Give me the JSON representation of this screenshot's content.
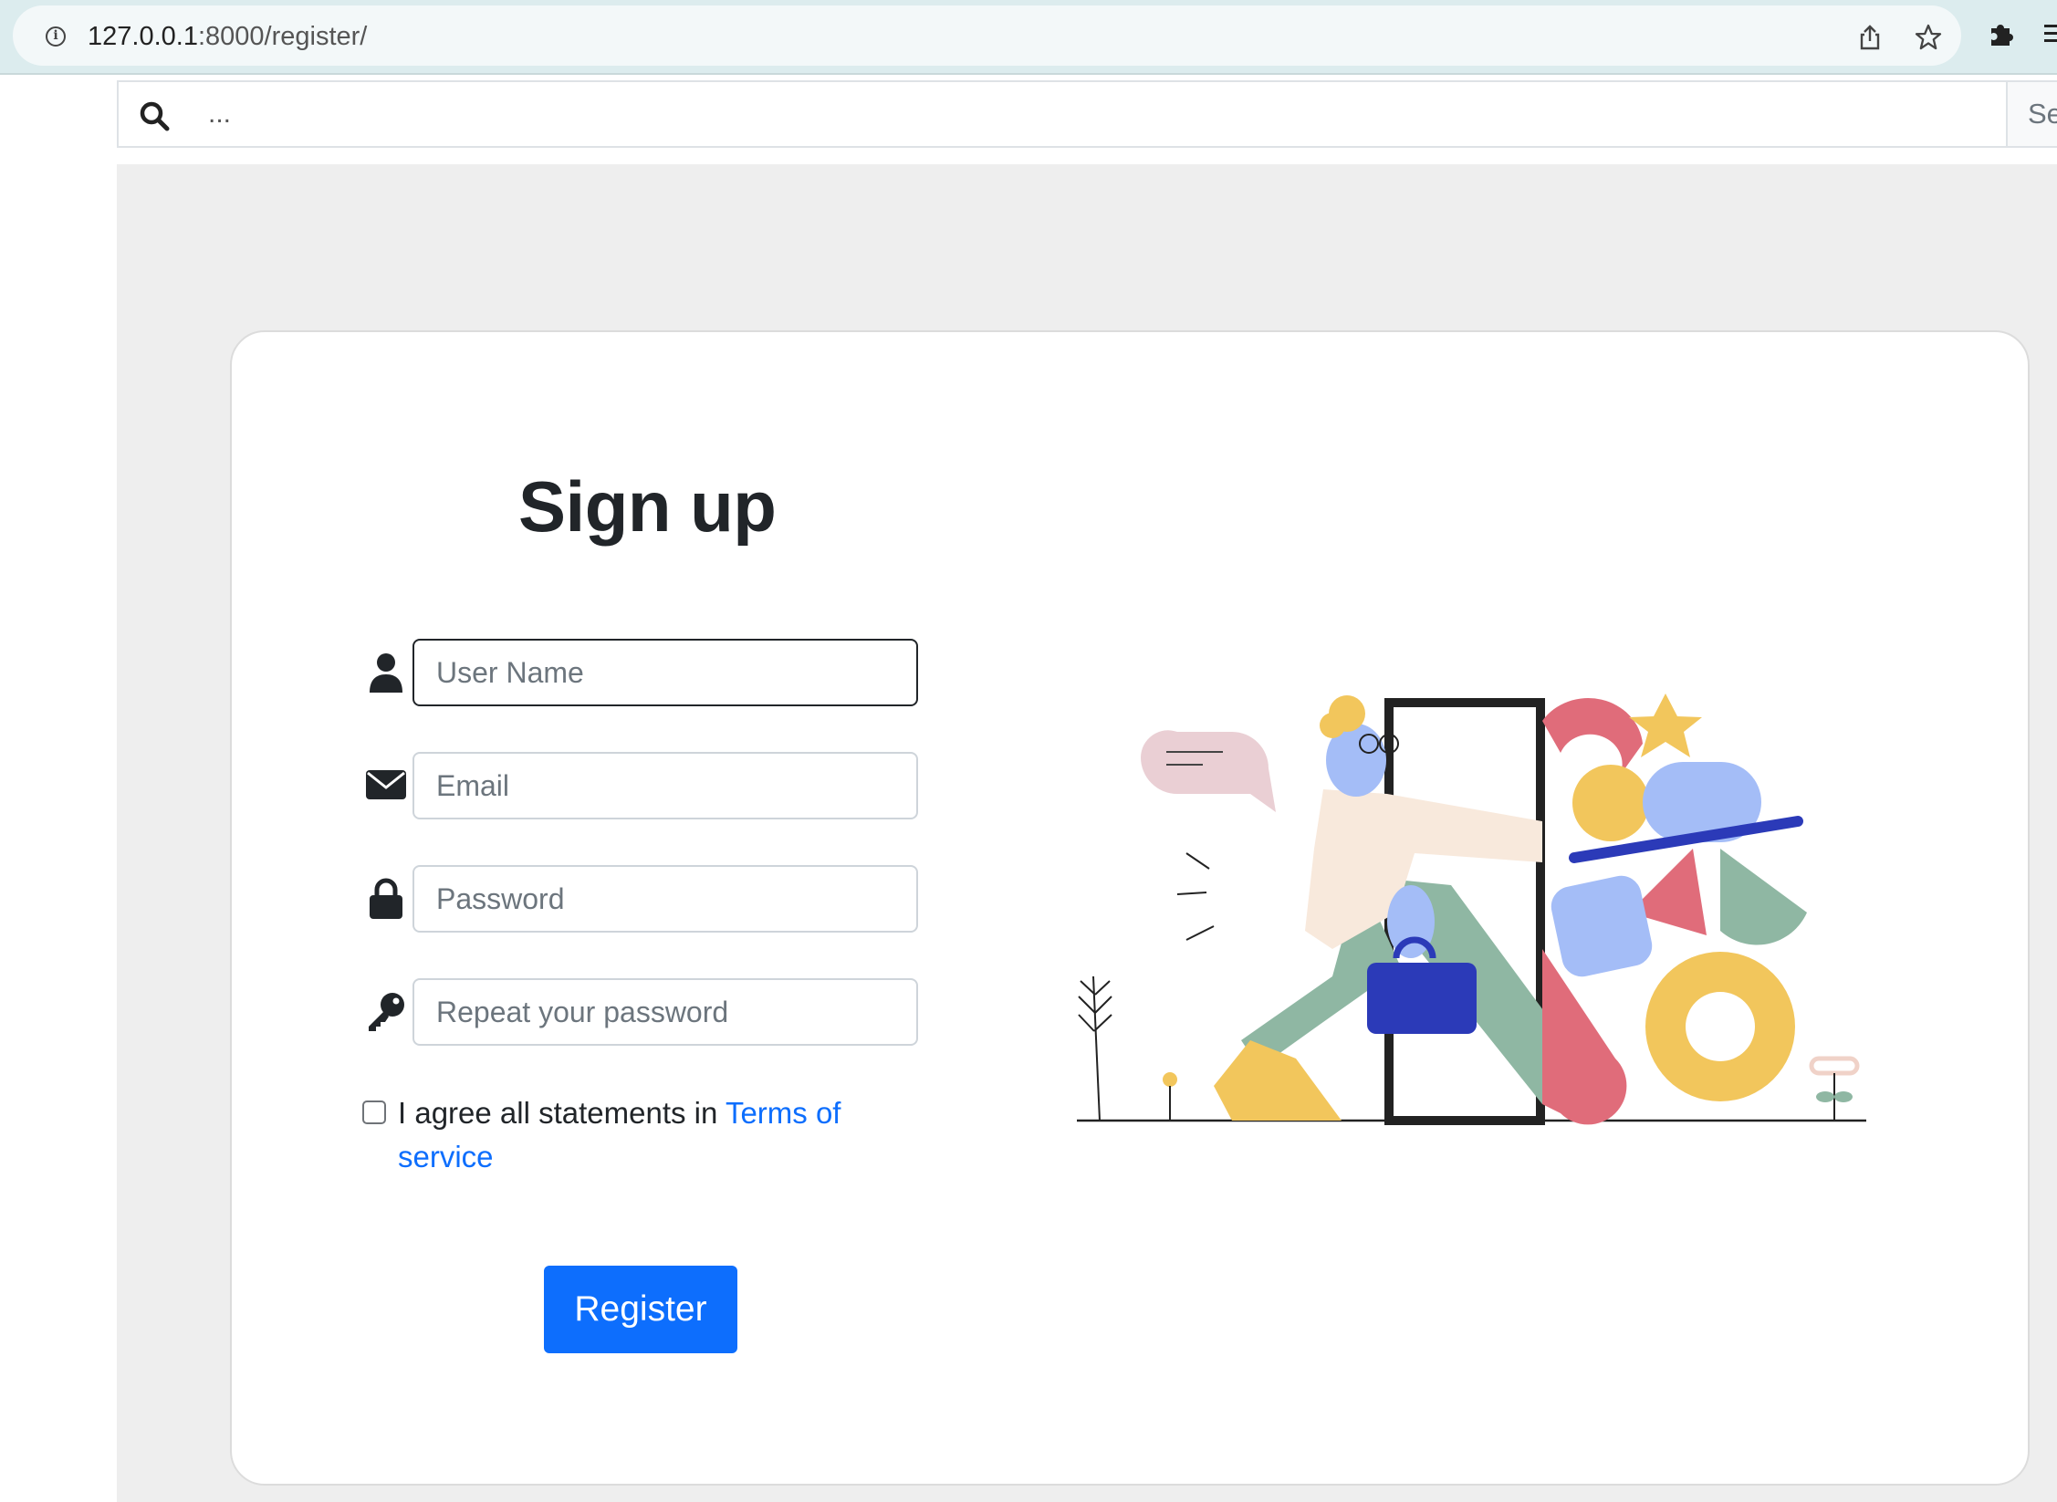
{
  "browser": {
    "url_host": "127.0.0.1",
    "url_rest": ":8000/register/",
    "icons": [
      "info-icon",
      "share-icon",
      "star-icon",
      "extensions-icon",
      "menu-icon"
    ]
  },
  "search": {
    "value": "...",
    "button_label": "Se"
  },
  "form": {
    "title": "Sign up",
    "fields": [
      {
        "icon": "user-icon",
        "placeholder": "User Name",
        "value": ""
      },
      {
        "icon": "envelope-icon",
        "placeholder": "Email",
        "value": ""
      },
      {
        "icon": "lock-icon",
        "placeholder": "Password",
        "value": ""
      },
      {
        "icon": "key-icon",
        "placeholder": "Repeat your password",
        "value": ""
      }
    ],
    "agree_text": "I agree all statements in ",
    "terms_link": "Terms of service",
    "agree_checked": false,
    "register_label": "Register"
  },
  "colors": {
    "primary": "#0d6efd",
    "page_bg": "#eeeeee",
    "chrome_bg": "#dcecee"
  }
}
